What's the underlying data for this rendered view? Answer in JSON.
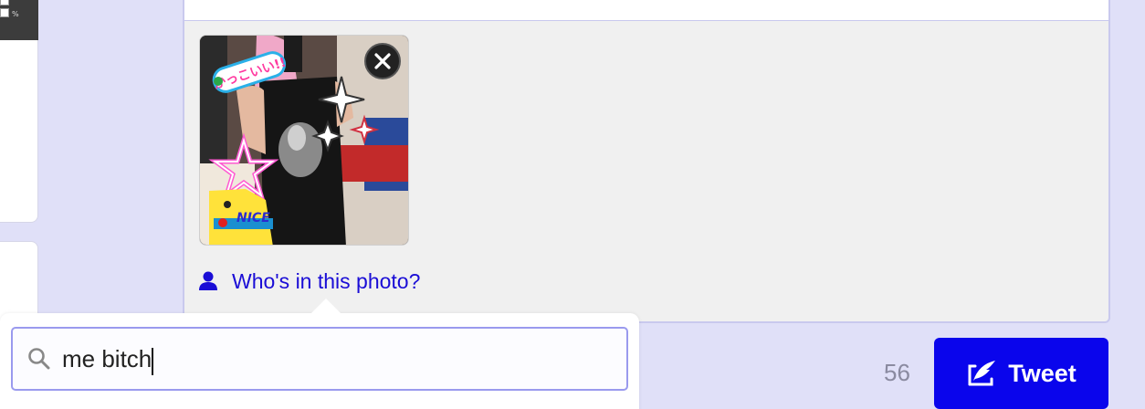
{
  "left_panel": {
    "percent_label": "%"
  },
  "media": {
    "tag_link_label": "Who's in this photo?",
    "photo_stickers": [
      "かっこいい!!",
      "NICE"
    ]
  },
  "toolbar": {
    "counter": "56",
    "tweet_label": "Tweet",
    "icons": [
      "camera-icon",
      "gif-icon",
      "poll-icon",
      "location-icon"
    ]
  },
  "tag_search": {
    "value": "me bitch",
    "placeholder": ""
  },
  "colors": {
    "page_bg": "#e0e0f8",
    "accent": "#0a05ec",
    "link": "#1a0dd6"
  }
}
